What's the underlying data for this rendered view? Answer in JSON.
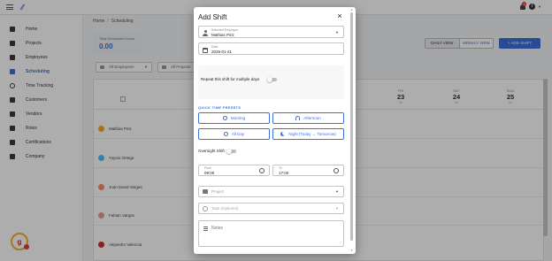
{
  "topbar": {
    "notification_count": "1",
    "info_label": "i"
  },
  "sidebar": {
    "items": [
      {
        "label": "Home",
        "icon": "home-icon"
      },
      {
        "label": "Projects",
        "icon": "projects-icon"
      },
      {
        "label": "Employees",
        "icon": "employees-icon"
      },
      {
        "label": "Scheduling",
        "icon": "calendar-icon"
      },
      {
        "label": "Time Tracking",
        "icon": "clock-icon"
      },
      {
        "label": "Customers",
        "icon": "customers-icon"
      },
      {
        "label": "Vendors",
        "icon": "vendors-icon"
      },
      {
        "label": "Roles",
        "icon": "roles-icon"
      },
      {
        "label": "Certifications",
        "icon": "certifications-icon"
      },
      {
        "label": "Company",
        "icon": "company-icon"
      }
    ],
    "active_index": 3,
    "help_label": "g"
  },
  "main": {
    "breadcrumb": {
      "home": "Home",
      "separator": "/",
      "current": "Scheduling"
    },
    "stat": {
      "title": "Total Scheduled Hours",
      "value": "0.00"
    },
    "view_toggle": {
      "daily": "DAILY VIEW",
      "weekly": "WEEKLY VIEW"
    },
    "add_shift_button": "ADD SHIFT",
    "filters": {
      "employees": "All Employees",
      "projects": "All Projects"
    },
    "days": [
      {
        "name": "FRI",
        "date": "23",
        "hours": "0h"
      },
      {
        "name": "SAT",
        "date": "24",
        "hours": "0h"
      },
      {
        "name": "SUN",
        "date": "25",
        "hours": "0h"
      }
    ],
    "employees": [
      {
        "name": "Mathias Piriz",
        "color": "#f9a825"
      },
      {
        "name": "Yoyoni Ortega",
        "color": "#4fc3f7"
      },
      {
        "name": "Juan David Vargas",
        "color": "#ff8a65"
      },
      {
        "name": "Fabian Vargas",
        "color": "#ef9a9a"
      },
      {
        "name": "Alejandro Valencia",
        "color": "#d32f2f"
      }
    ]
  },
  "modal": {
    "title": "Add Shift",
    "close_symbol": "×",
    "employee": {
      "label": "Selected Employee",
      "value": "Mathias Piriz"
    },
    "date": {
      "label": "Date",
      "value": "2026-01-21"
    },
    "repeat_label": "Repeat this shift for multiple days",
    "presets_title": "QUICK TIME PRESETS",
    "presets": {
      "morning": "Morning",
      "afternoon": "Afternoon",
      "all_day": "All Day",
      "night": "Night (Today → Tomorrow)"
    },
    "overnight_label": "Overnight Shift",
    "from": {
      "label": "From",
      "value": "09:00"
    },
    "to": {
      "label": "To",
      "value": "17:00"
    },
    "project": {
      "placeholder": "Project"
    },
    "task": {
      "placeholder": "Task (Optional)"
    },
    "notes": {
      "placeholder": "Notes"
    }
  },
  "colors": {
    "accent": "#3f6fd8",
    "overlay": "rgba(0,0,0,0.32)"
  }
}
